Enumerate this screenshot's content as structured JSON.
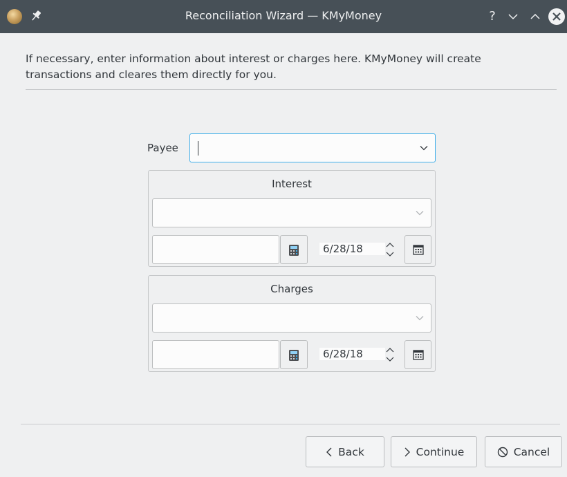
{
  "window": {
    "title": "Reconciliation Wizard — KMyMoney",
    "controls": {
      "help": "?",
      "minimize": "∨",
      "maximize": "∧"
    },
    "icons": [
      "app-icon",
      "pin-icon",
      "close-icon"
    ]
  },
  "intro": {
    "text": "If necessary, enter information about interest or charges here. KMyMoney will create transactions and cleares them directly for you."
  },
  "payee": {
    "label": "Payee",
    "value": ""
  },
  "interest": {
    "title": "Interest",
    "category": "",
    "amount": "",
    "date": "6/28/18"
  },
  "charges": {
    "title": "Charges",
    "category": "",
    "amount": "",
    "date": "6/28/18"
  },
  "buttons": {
    "back": "Back",
    "continue": "Continue",
    "cancel": "Cancel"
  },
  "colors": {
    "titlebar": "#475057",
    "background": "#eff0f1",
    "focus": "#3daee9",
    "text": "#31363b"
  }
}
